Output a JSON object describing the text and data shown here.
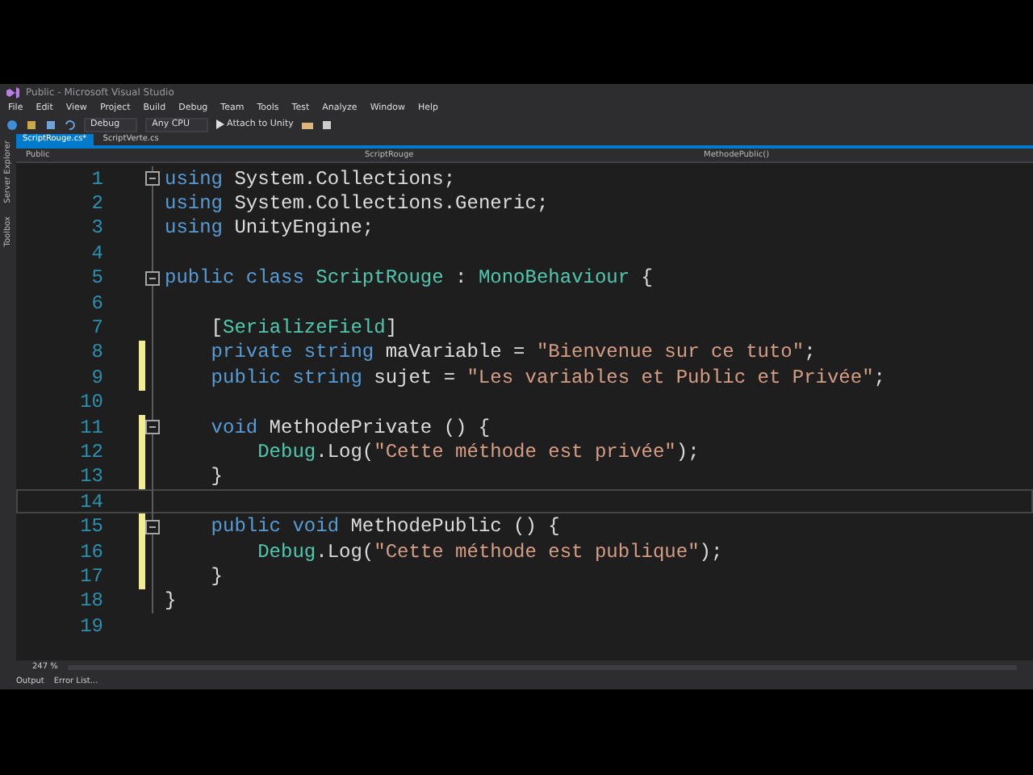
{
  "window": {
    "title": "Public - Microsoft Visual Studio"
  },
  "menu": [
    "File",
    "Edit",
    "View",
    "Project",
    "Build",
    "Debug",
    "Team",
    "Tools",
    "Test",
    "Analyze",
    "Window",
    "Help"
  ],
  "toolbar": {
    "configuration": "Debug",
    "platform": "Any CPU",
    "run_label": "Attach to Unity"
  },
  "side_tabs": [
    "Server Explorer",
    "Toolbox"
  ],
  "tabs": [
    {
      "label": "ScriptRouge.cs*",
      "selected": true
    },
    {
      "label": "ScriptVerte.cs",
      "selected": false
    }
  ],
  "nav": {
    "project": "Public",
    "class": "ScriptRouge",
    "member": "MethodePublic()"
  },
  "code": [
    {
      "number": "1",
      "collapsible": true,
      "changed": false,
      "current": false,
      "tokens": [
        {
          "kind": "keyword",
          "text": "using"
        },
        {
          "kind": "plain",
          "text": " System.Collections;"
        }
      ]
    },
    {
      "number": "2",
      "collapsible": false,
      "changed": false,
      "current": false,
      "tokens": [
        {
          "kind": "keyword",
          "text": "using"
        },
        {
          "kind": "plain",
          "text": " System.Collections.Generic;"
        }
      ]
    },
    {
      "number": "3",
      "collapsible": false,
      "changed": false,
      "current": false,
      "tokens": [
        {
          "kind": "keyword",
          "text": "using"
        },
        {
          "kind": "plain",
          "text": " UnityEngine;"
        }
      ]
    },
    {
      "number": "4",
      "collapsible": false,
      "changed": false,
      "current": false
    },
    {
      "number": "5",
      "collapsible": true,
      "changed": false,
      "current": false,
      "tokens": [
        {
          "kind": "keyword",
          "text": "public class "
        },
        {
          "kind": "type",
          "text": "ScriptRouge"
        },
        {
          "kind": "plain",
          "text": " : "
        },
        {
          "kind": "type",
          "text": "MonoBehaviour"
        },
        {
          "kind": "plain",
          "text": " {"
        }
      ]
    },
    {
      "number": "6",
      "collapsible": false,
      "changed": false,
      "current": false
    },
    {
      "number": "7",
      "collapsible": false,
      "changed": false,
      "current": false,
      "tokens": [
        {
          "kind": "plain",
          "text": "    ["
        },
        {
          "kind": "type",
          "text": "SerializeField"
        },
        {
          "kind": "plain",
          "text": "]"
        }
      ]
    },
    {
      "number": "8",
      "collapsible": false,
      "changed": true,
      "current": false,
      "tokens": [
        {
          "kind": "keyword",
          "text": "    private string"
        },
        {
          "kind": "plain",
          "text": " maVariable = "
        },
        {
          "kind": "string",
          "text": "\"Bienvenue sur ce tuto\""
        },
        {
          "kind": "plain",
          "text": ";"
        }
      ]
    },
    {
      "number": "9",
      "collapsible": false,
      "changed": true,
      "current": false,
      "tokens": [
        {
          "kind": "keyword",
          "text": "    public string"
        },
        {
          "kind": "plain",
          "text": " sujet = "
        },
        {
          "kind": "string",
          "text": "\"Les variables et Public et Privée\""
        },
        {
          "kind": "plain",
          "text": ";"
        }
      ]
    },
    {
      "number": "10",
      "collapsible": false,
      "changed": false,
      "current": false
    },
    {
      "number": "11",
      "collapsible": true,
      "changed": true,
      "current": false,
      "tokens": [
        {
          "kind": "keyword",
          "text": "    void"
        },
        {
          "kind": "plain",
          "text": " MethodePrivate () {"
        }
      ]
    },
    {
      "number": "12",
      "collapsible": false,
      "changed": true,
      "current": false,
      "tokens": [
        {
          "kind": "type",
          "text": "        Debug"
        },
        {
          "kind": "plain",
          "text": ".Log("
        },
        {
          "kind": "string",
          "text": "\"Cette méthode est privée\""
        },
        {
          "kind": "plain",
          "text": ");"
        }
      ]
    },
    {
      "number": "13",
      "collapsible": false,
      "changed": true,
      "current": false,
      "tokens": [
        {
          "kind": "plain",
          "text": "    }"
        }
      ]
    },
    {
      "number": "14",
      "collapsible": false,
      "changed": false,
      "current": true
    },
    {
      "number": "15",
      "collapsible": true,
      "changed": true,
      "current": false,
      "tokens": [
        {
          "kind": "keyword",
          "text": "    public void"
        },
        {
          "kind": "plain",
          "text": " MethodePublic () {"
        }
      ]
    },
    {
      "number": "16",
      "collapsible": false,
      "changed": true,
      "current": false,
      "tokens": [
        {
          "kind": "type",
          "text": "        Debug"
        },
        {
          "kind": "plain",
          "text": ".Log("
        },
        {
          "kind": "string",
          "text": "\"Cette méthode est publique\""
        },
        {
          "kind": "plain",
          "text": ");"
        }
      ]
    },
    {
      "number": "17",
      "collapsible": false,
      "changed": true,
      "current": false,
      "tokens": [
        {
          "kind": "plain",
          "text": "    }"
        }
      ]
    },
    {
      "number": "18",
      "collapsible": false,
      "changed": false,
      "current": false,
      "tokens": [
        {
          "kind": "plain",
          "text": "}"
        }
      ]
    },
    {
      "number": "19",
      "collapsible": false,
      "changed": false,
      "current": false
    }
  ],
  "zoom": "247 %",
  "bottom_tabs": [
    "Output",
    "Error List..."
  ]
}
